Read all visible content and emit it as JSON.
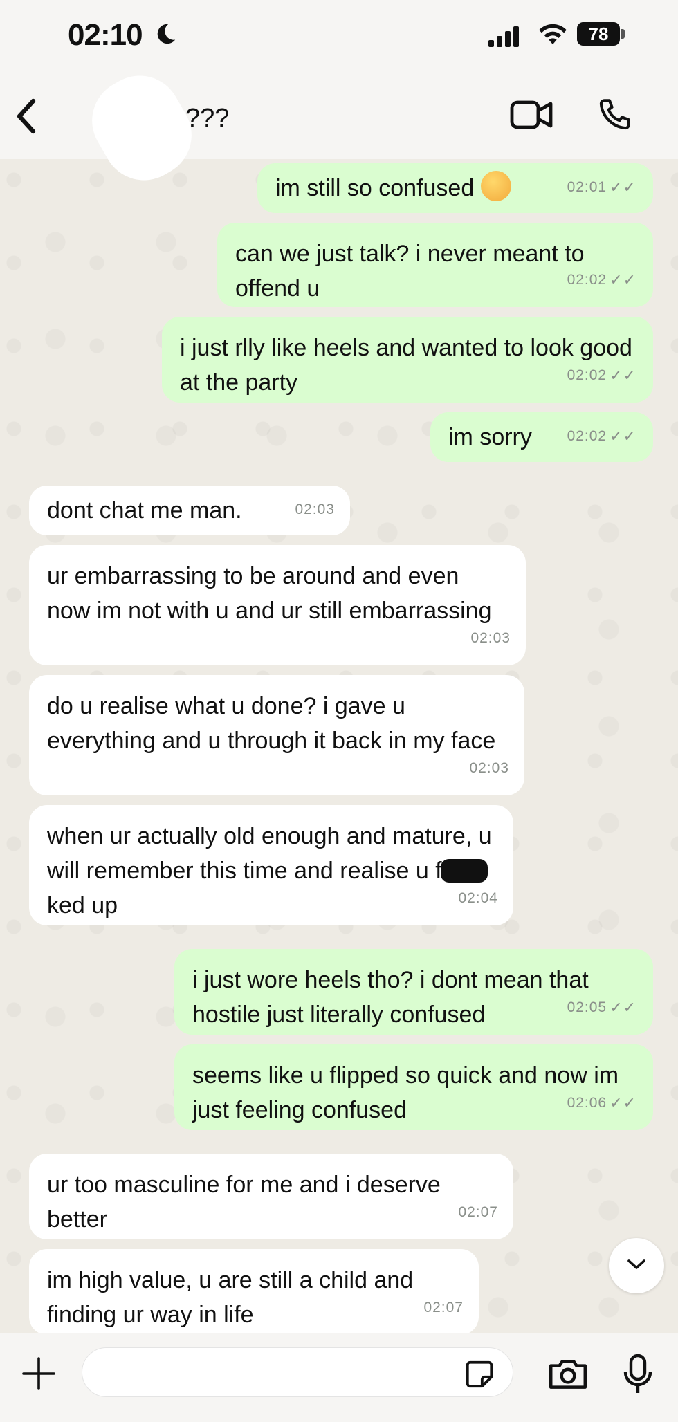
{
  "status_bar": {
    "time": "02:10",
    "battery": "78"
  },
  "header": {
    "contact_name": "???"
  },
  "messages": [
    {
      "dir": "out",
      "text": "im still so confused",
      "time": "02:01",
      "emoji": true
    },
    {
      "dir": "out",
      "text": "can we just talk? i never meant to offend u",
      "time": "02:02"
    },
    {
      "dir": "out",
      "text": "i just rlly like heels and wanted to look good at the party",
      "time": "02:02"
    },
    {
      "dir": "out",
      "text": "im sorry",
      "time": "02:02"
    },
    {
      "dir": "in",
      "text": "dont chat me man.",
      "time": "02:03"
    },
    {
      "dir": "in",
      "text": "ur embarrassing to be around and even now im not with u and ur still embarrassing",
      "time": "02:03"
    },
    {
      "dir": "in",
      "text": "do u realise what u done? i gave u everything and u through it back in my face",
      "time": "02:03"
    },
    {
      "dir": "in",
      "text_before": "when ur actually old enough and mature, u will remember this time and realise u f",
      "text_after": "ked up",
      "time": "02:04"
    },
    {
      "dir": "out",
      "text": "i just wore heels tho? i dont mean that hostile just literally confused",
      "time": "02:05"
    },
    {
      "dir": "out",
      "text": "seems like u flipped so quick and now im just feeling confused",
      "time": "02:06"
    },
    {
      "dir": "in",
      "text": "ur too masculine for me and i deserve better",
      "time": "02:07"
    },
    {
      "dir": "in",
      "text": "im high value, u are still a child and finding ur way in life",
      "time": "02:07"
    }
  ],
  "input": {
    "value": "",
    "placeholder": ""
  },
  "colors": {
    "outgoing_bubble": "#dafdd0",
    "incoming_bubble": "#ffffff",
    "background": "#eeebe4"
  },
  "icons": [
    "back-icon",
    "video-call-icon",
    "voice-call-icon",
    "plus-icon",
    "sticker-icon",
    "camera-icon",
    "mic-icon",
    "chevron-down-icon"
  ]
}
